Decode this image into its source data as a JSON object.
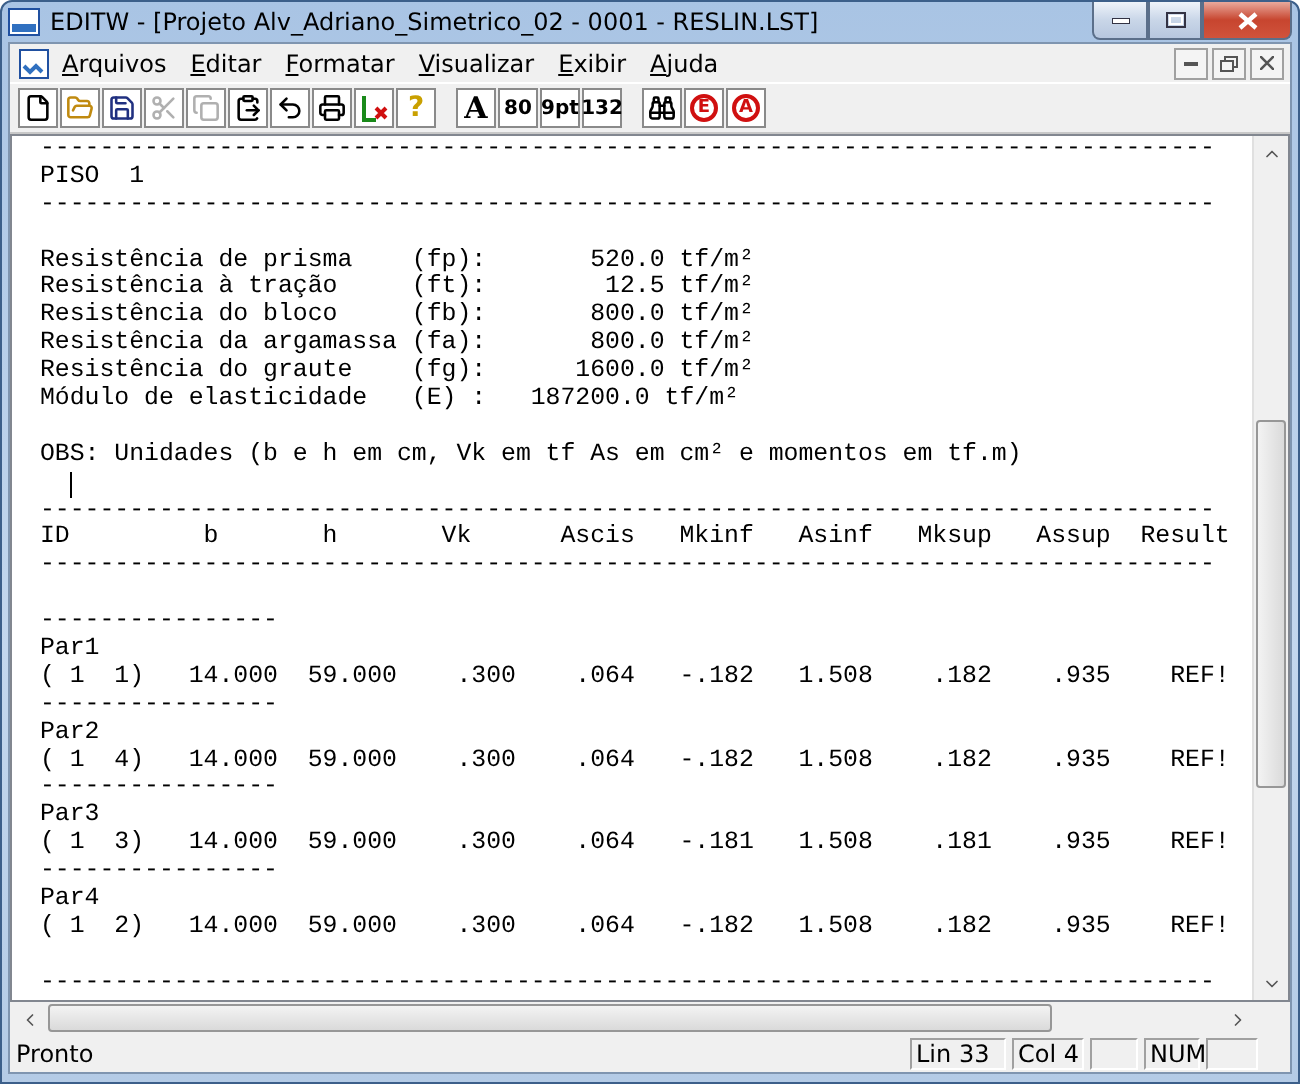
{
  "window": {
    "title": "EDITW - [Projeto Alv_Adriano_Simetrico_02 - 0001 - RESLIN.LST]"
  },
  "menu": [
    {
      "label": "Arquivos"
    },
    {
      "label": "Editar"
    },
    {
      "label": "Formatar"
    },
    {
      "label": "Visualizar"
    },
    {
      "label": "Exibir"
    },
    {
      "label": "Ajuda"
    }
  ],
  "toolbar": [
    {
      "kind": "new",
      "disabled": false
    },
    {
      "kind": "open",
      "disabled": false
    },
    {
      "kind": "save",
      "disabled": false
    },
    {
      "kind": "cut",
      "disabled": true
    },
    {
      "kind": "copy",
      "disabled": true
    },
    {
      "kind": "paste",
      "disabled": false
    },
    {
      "kind": "undo",
      "disabled": false
    },
    {
      "kind": "print",
      "disabled": false
    },
    {
      "kind": "clear",
      "disabled": false
    },
    {
      "kind": "help",
      "label": "?",
      "disabled": false
    },
    {
      "kind": "separator"
    },
    {
      "kind": "font",
      "label": "A",
      "disabled": false
    },
    {
      "kind": "text",
      "label": "80",
      "disabled": false
    },
    {
      "kind": "text",
      "label": "9pt",
      "disabled": false
    },
    {
      "kind": "text",
      "label": "132",
      "disabled": false
    },
    {
      "kind": "separator"
    },
    {
      "kind": "find",
      "disabled": false
    },
    {
      "kind": "circled",
      "label": "E",
      "disabled": false
    },
    {
      "kind": "circled",
      "label": "A",
      "disabled": false
    }
  ],
  "document": {
    "blocks": [
      {
        "lines": [
          "-------------------------------------------------------------------------------",
          "PISO  1",
          "-------------------------------------------------------------------------------"
        ],
        "caret_after": false
      },
      {
        "lines": [
          "Resistência de prisma    (fp):       520.0 tf/m²",
          "Resistência à tração     (ft):        12.5 tf/m²",
          "Resistência do bloco     (fb):       800.0 tf/m²",
          "Resistência da argamassa (fa):       800.0 tf/m²",
          "Resistência do graute    (fg):      1600.0 tf/m²",
          "Módulo de elasticidade   (E) :   187200.0 tf/m²"
        ],
        "caret_after": false
      },
      {
        "lines": [
          "OBS: Unidades (b e h em cm, Vk em tf As em cm² e momentos em tf.m)"
        ],
        "caret_after": true
      },
      {
        "lines": [
          "-------------------------------------------------------------------------------",
          "ID         b       h       Vk      Ascis   Mkinf   Asinf   Mksup   Assup  Result",
          "-------------------------------------------------------------------------------"
        ],
        "caret_after": false
      },
      {
        "lines": [
          "----------------",
          "Par1",
          "( 1  1)   14.000  59.000    .300    .064   -.182   1.508    .182    .935    REF!",
          "----------------",
          "Par2",
          "( 1  4)   14.000  59.000    .300    .064   -.182   1.508    .182    .935    REF!",
          "----------------",
          "Par3",
          "( 1  3)   14.000  59.000    .300    .064   -.181   1.508    .181    .935    REF!",
          "----------------",
          "Par4",
          "( 1  2)   14.000  59.000    .300    .064   -.182   1.508    .182    .935    REF!"
        ],
        "caret_after": false
      },
      {
        "lines": [
          "-------------------------------------------------------------------------------"
        ],
        "caret_after": false
      }
    ]
  },
  "status_bar": {
    "message": "Pronto",
    "panes": [
      "Lin 33",
      "Col 4",
      "NUM"
    ]
  }
}
